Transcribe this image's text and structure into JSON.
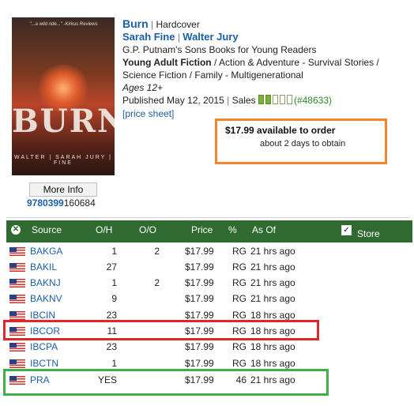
{
  "book": {
    "cover_title": "BURN",
    "cover_authors": "WALTER | SARAH JURY | FINE",
    "cover_quote": "\"...a wild ride...\" -Kirkus Reviews",
    "title": "Burn",
    "format": "Hardcover",
    "author1": "Sarah Fine",
    "author2": "Walter Jury",
    "publisher": "G.P. Putnam's Sons Books for Young Readers",
    "category_bold": "Young Adult Fiction",
    "category_rest": " / Action & Adventure - Survival Stories /",
    "category_line2": "Science Fiction / Family - Multigenerational",
    "ages": "Ages 12+",
    "published": "Published May 12, 2015",
    "sales_label": "Sales",
    "sales_filled": 2,
    "sales_total": 5,
    "sales_rank_open": "(",
    "sales_rank": "#48633",
    "sales_rank_close": ")",
    "price_sheet": "[price sheet]",
    "more_info": "More Info",
    "isbn_link": "9780399",
    "isbn_rest": "160684"
  },
  "availability": {
    "price_text": "$17.99 available to order",
    "days_text": "about 2 days to obtain"
  },
  "table": {
    "headers": {
      "source": "Source",
      "oh": "O/H",
      "oo": "O/O",
      "price": "Price",
      "pct": "%",
      "asof": "As Of",
      "store": "Store"
    },
    "close_glyph": "✕",
    "check_glyph": "✓",
    "rows": [
      {
        "source": "BAKGA",
        "oh": "1",
        "oo": "2",
        "price": "$17.99",
        "pct": "RG",
        "asof": "21 hrs ago"
      },
      {
        "source": "BAKIL",
        "oh": "27",
        "oo": "",
        "price": "$17.99",
        "pct": "RG",
        "asof": "21 hrs ago"
      },
      {
        "source": "BAKNJ",
        "oh": "1",
        "oo": "2",
        "price": "$17.99",
        "pct": "RG",
        "asof": "21 hrs ago"
      },
      {
        "source": "BAKNV",
        "oh": "9",
        "oo": "",
        "price": "$17.99",
        "pct": "RG",
        "asof": "21 hrs ago"
      },
      {
        "source": "IBCIN",
        "oh": "23",
        "oo": "",
        "price": "$17.99",
        "pct": "RG",
        "asof": "18 hrs ago"
      },
      {
        "source": "IBCOR",
        "oh": "11",
        "oo": "",
        "price": "$17.99",
        "pct": "RG",
        "asof": "18 hrs ago"
      },
      {
        "source": "IBCPA",
        "oh": "23",
        "oo": "",
        "price": "$17.99",
        "pct": "RG",
        "asof": "18 hrs ago"
      },
      {
        "source": "IBCTN",
        "oh": "1",
        "oo": "",
        "price": "$17.99",
        "pct": "RG",
        "asof": "18 hrs ago"
      },
      {
        "source": "PRA",
        "oh": "YES",
        "oo": "",
        "price": "$17.99",
        "pct": "46",
        "asof": "21 hrs ago"
      }
    ]
  },
  "colors": {
    "header_green": "#2f6b31",
    "link_blue": "#1a5fa8",
    "orange_box": "#f5842d",
    "red_box": "#e0262b",
    "green_box": "#3db04a"
  }
}
